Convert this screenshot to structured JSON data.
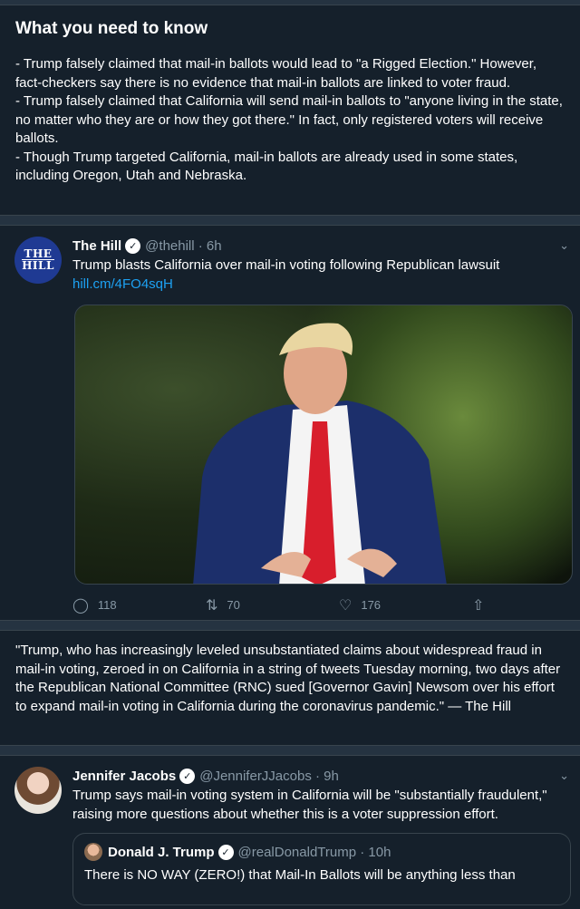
{
  "know": {
    "title": "What you need to know",
    "body": "- Trump falsely claimed that mail-in ballots would lead to \"a Rigged Election.\" However, fact-checkers say there is no evidence that mail-in ballots are linked to voter fraud.\n- Trump falsely claimed that California will send mail-in ballots to \"anyone living in the state, no matter who they are or how they got there.\" In fact, only registered voters will receive ballots.\n- Though Trump targeted California, mail-in ballots are already used in some states, including Oregon, Utah and Nebraska."
  },
  "tweet1": {
    "avatar_l1": "THE",
    "avatar_l2": "HILL",
    "name": "The Hill",
    "handle": "@thehill · 6h",
    "text": "Trump blasts California over mail-in voting following Republican lawsuit",
    "link": "hill.cm/4FO4sqH",
    "replies": "118",
    "retweets": "70",
    "likes": "176"
  },
  "quote": {
    "text": "\"Trump, who has increasingly leveled unsubstantiated claims about widespread fraud in mail-in voting, zeroed in on California in a string of tweets Tuesday morning, two days after the Republican National Committee (RNC) sued [Governor Gavin] Newsom over his effort to expand mail-in voting in California during the coronavirus pandemic.\" — The Hill"
  },
  "tweet2": {
    "name": "Jennifer Jacobs",
    "handle": "@JenniferJJacobs · 9h",
    "text": "Trump says mail-in voting system in California will be \"substantially fraudulent,\" raising more questions about whether this is a voter suppression effort.",
    "embed": {
      "name": "Donald J. Trump",
      "handle": "@realDonaldTrump · 10h",
      "text": "There is NO WAY (ZERO!) that Mail-In Ballots will be anything less than"
    }
  },
  "icons": {
    "verified": "verified-badge-icon",
    "chevron": "chevron-down-icon",
    "reply": "reply-icon",
    "retweet": "retweet-icon",
    "like": "heart-icon",
    "share": "share-icon"
  },
  "colors": {
    "background": "#15202b",
    "separator": "#253341",
    "link": "#1da1f2",
    "muted": "#8899a6",
    "tie": "#d81e2c"
  }
}
